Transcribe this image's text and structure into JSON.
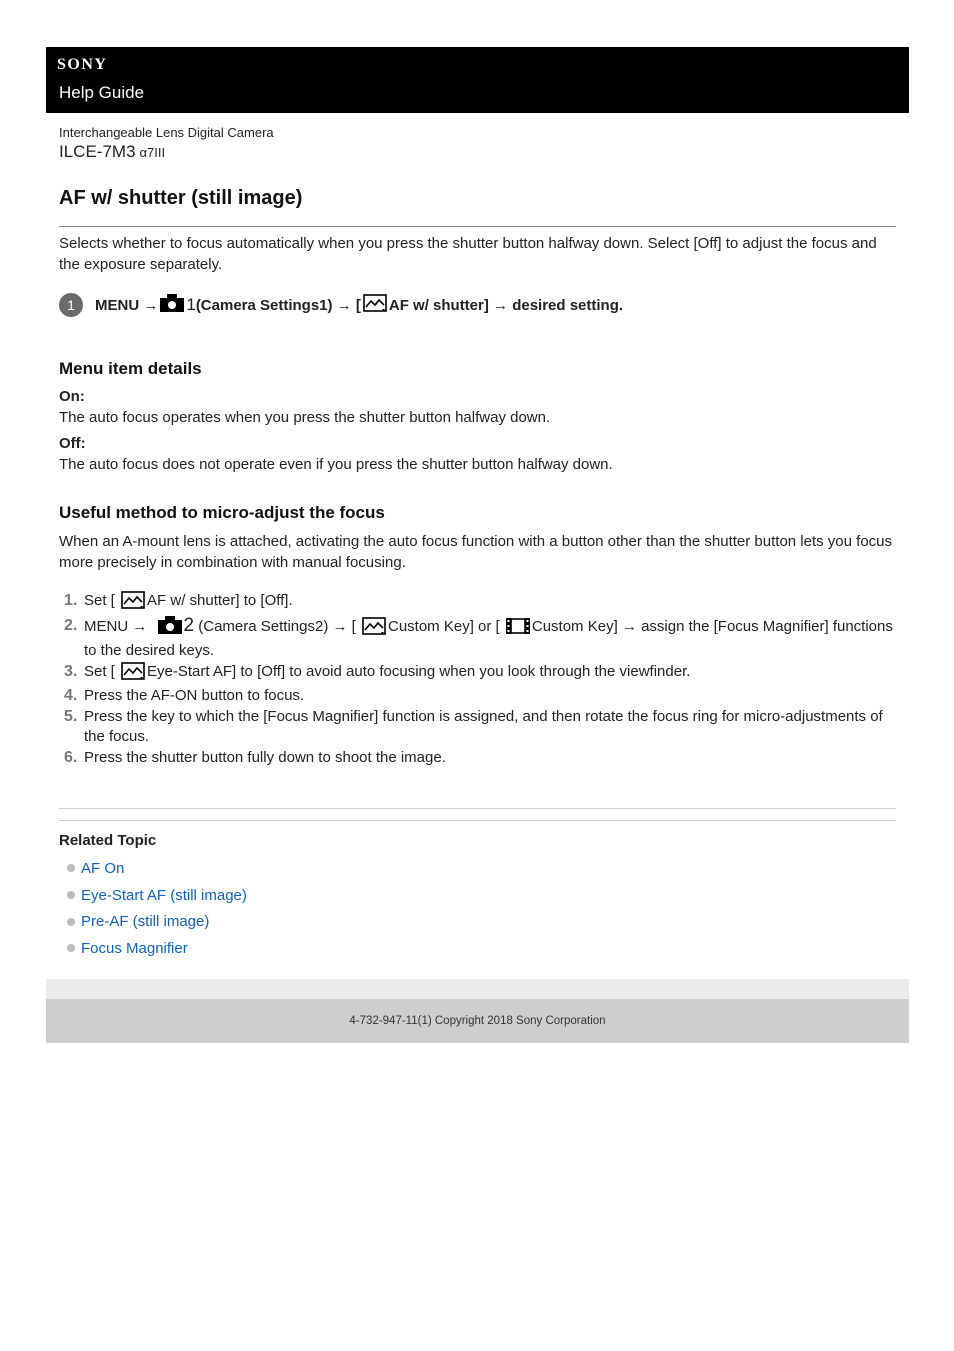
{
  "header": {
    "brand": "SONY",
    "title": "Help Guide"
  },
  "product": {
    "category": "Interchangeable Lens Digital Camera",
    "model": "ILCE-7M3",
    "model_alt": "α7III"
  },
  "page_title": "AF w/ shutter (still image)",
  "intro": "Selects whether to focus automatically when you press the shutter button halfway down. Select [Off] to adjust the focus and the exposure separately.",
  "step": {
    "number": "1",
    "part1": "MENU →",
    "cam_num": "1",
    "part2": "(Camera Settings1) → [",
    "part3": "AF w/ shutter] → desired setting."
  },
  "menu_details": {
    "heading": "Menu item details",
    "items": [
      {
        "term": "On:",
        "desc": "The auto focus operates when you press the shutter button halfway down."
      },
      {
        "term": "Off:",
        "desc": "The auto focus does not operate even if you press the shutter button halfway down."
      }
    ]
  },
  "useful": {
    "heading": "Useful method to micro-adjust the focus",
    "paragraph": "When an A-mount lens is attached, activating the auto focus function with a button other than the shutter button lets you focus more precisely in combination with manual focusing.",
    "steps": [
      {
        "n": "1.",
        "a": "Set [",
        "b": "AF w/ shutter] to [Off]."
      },
      {
        "n": "2.",
        "a": "MENU →",
        "cam": "2",
        "b": "(Camera Settings2) → [",
        "c": "Custom Key] or [",
        "d": "Custom Key] → assign the [Focus Magnifier] functions to the desired keys."
      },
      {
        "n": "3.",
        "a": "Set [",
        "b": "Eye-Start AF] to [Off] to avoid auto focusing when you look through the viewfinder."
      },
      {
        "n": "4.",
        "a": "Press the AF-ON button to focus."
      },
      {
        "n": "5.",
        "a": "Press the key to which the [Focus Magnifier] function is assigned, and then rotate the focus ring for micro-adjustments of the focus."
      },
      {
        "n": "6.",
        "a": "Press the shutter button fully down to shoot the image."
      }
    ]
  },
  "related": {
    "heading": "Related Topic",
    "links": [
      "AF On",
      "Eye-Start AF (still image)",
      "Pre-AF (still image)",
      "Focus Magnifier"
    ]
  },
  "footer": {
    "copyright": "4-732-947-11(1) Copyright 2018 Sony Corporation"
  },
  "colors": {
    "link": "#1060c0",
    "header_bg": "#000000",
    "footer_bg": "#cecece"
  }
}
